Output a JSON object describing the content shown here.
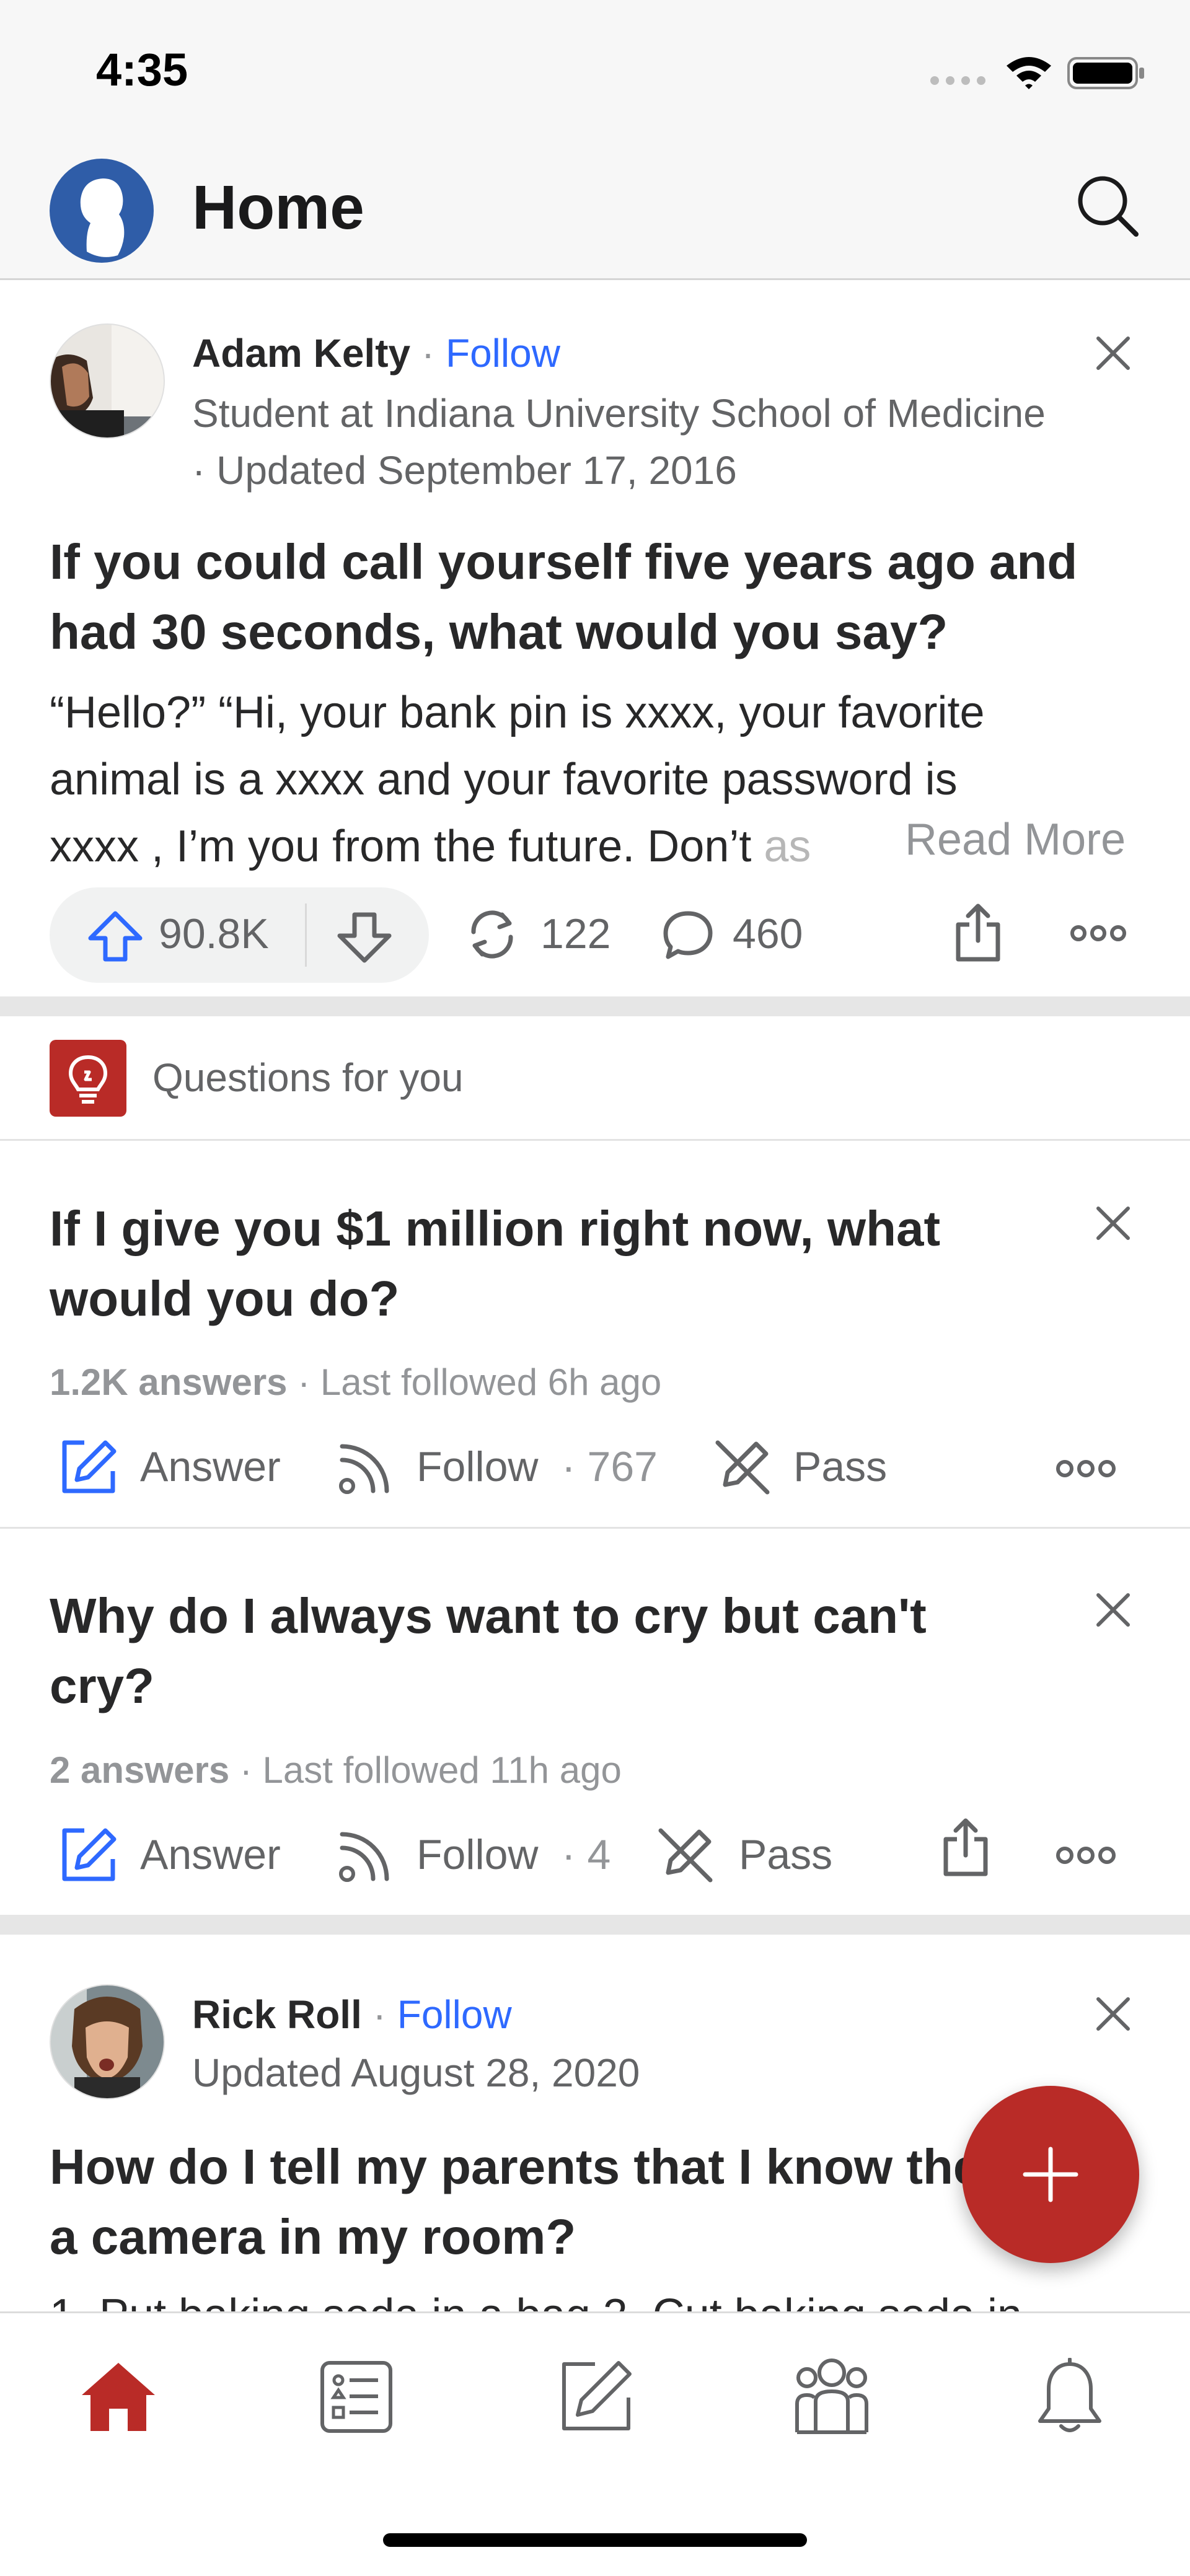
{
  "status_bar": {
    "time": "4:35"
  },
  "header": {
    "title": "Home"
  },
  "post1": {
    "author": "Adam Kelty",
    "separator": "·",
    "follow_label": "Follow",
    "credential": "Student at Indiana University School of Medicine",
    "updated": "· Updated September 17, 2016",
    "question": "If you could call yourself five years ago and had 30 seconds, what would you say?",
    "body_line1": "“Hello?” “Hi, your bank pin is xxxx, your favorite",
    "body_line2": "animal is a xxxx and your favorite password is",
    "body_line3": "xxxx , I’m you from the future. Don’t ",
    "body_faded": "as",
    "read_more": "Read More",
    "upvotes": "90.8K",
    "shares": "122",
    "comments": "460"
  },
  "questions_section": {
    "label": "Questions for you"
  },
  "question1": {
    "title": "If I give you $1 million right now, what would you do?",
    "answers": "1.2K answers",
    "last_followed": "· Last followed 6h ago",
    "answer_label": "Answer",
    "follow_label": "Follow",
    "follow_count": "· 767",
    "pass_label": "Pass"
  },
  "question2": {
    "title": "Why do I always want to cry but can't cry?",
    "answers": "2 answers",
    "last_followed": "· Last followed 11h ago",
    "answer_label": "Answer",
    "follow_label": "Follow",
    "follow_count": "· 4",
    "pass_label": "Pass"
  },
  "post2": {
    "author": "Rick Roll",
    "separator": "·",
    "follow_label": "Follow",
    "updated": "Updated August 28, 2020",
    "question": "How do I tell my parents that I know they put a camera in my room?",
    "body_partial": "1. Put baking soda in a bag 2. Cut baking soda in"
  },
  "tab_bar": {
    "items": [
      "home-icon",
      "answer-list-icon",
      "write-icon",
      "spaces-icon",
      "notifications-bell-icon"
    ],
    "active": "home-icon",
    "accent_color": "#b92b27"
  },
  "colors": {
    "brand_red": "#b92b27",
    "link_blue": "#2e69ff",
    "text_dark": "#282829",
    "text_muted": "#636466"
  }
}
